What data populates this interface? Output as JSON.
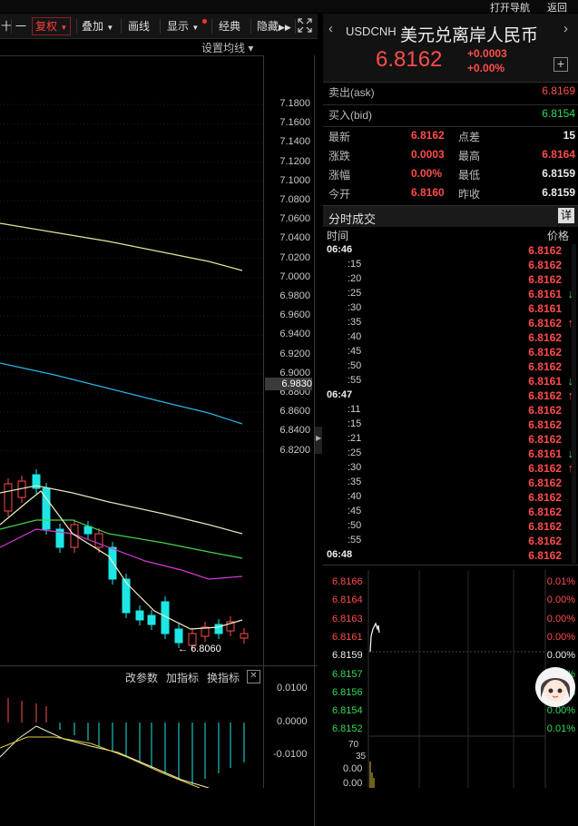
{
  "topbar": {
    "open_nav": "打开导航",
    "back": "返回"
  },
  "toolbar": {
    "items": [
      "十",
      "一",
      "复权",
      "叠加",
      "画线",
      "显示",
      "经典",
      "隐藏"
    ],
    "settings": "设置均线 ▾"
  },
  "main_chart": {
    "y_ticks": [
      "7.1800",
      "7.1600",
      "7.1400",
      "7.1200",
      "7.1000",
      "7.0800",
      "7.0600",
      "7.0400",
      "7.0200",
      "7.0000",
      "6.9800",
      "6.9600",
      "6.9400",
      "6.9200",
      "6.9000",
      "6.8800",
      "6.8600",
      "6.8400",
      "6.8200"
    ],
    "current_price_tag": "6.9830",
    "low_marker": "6.8060"
  },
  "indicator": {
    "buttons": [
      "改参数",
      "加指标",
      "换指标"
    ],
    "y_ticks": [
      "0.0100",
      "0.0000",
      "-0.0100"
    ]
  },
  "quote": {
    "symbol": "USDCNH",
    "name": "美元兑离岸人民币",
    "price": "6.8162",
    "change": "+0.0003",
    "change_pct": "+0.00%",
    "ask_label": "卖出(ask)",
    "ask": "6.8169",
    "bid_label": "买入(bid)",
    "bid": "6.8154",
    "stats": [
      {
        "l1": "最新",
        "v1": "6.8162",
        "c1": "red",
        "l2": "点差",
        "v2": "15",
        "c2": "white"
      },
      {
        "l1": "涨跌",
        "v1": "0.0003",
        "c1": "red",
        "l2": "最高",
        "v2": "6.8164",
        "c2": "red"
      },
      {
        "l1": "涨幅",
        "v1": "0.00%",
        "c1": "red",
        "l2": "最低",
        "v2": "6.8159",
        "c2": "white"
      },
      {
        "l1": "今开",
        "v1": "6.8160",
        "c1": "red",
        "l2": "昨收",
        "v2": "6.8159",
        "c2": "white"
      }
    ]
  },
  "ticks_panel": {
    "title": "分时成交",
    "detail_btn": "详",
    "col_time": "时间",
    "col_price": "价格",
    "rows": [
      {
        "t": "06:46",
        "p": "6.8162",
        "a": "",
        "b": true
      },
      {
        "t": ":15",
        "p": "6.8162",
        "a": ""
      },
      {
        "t": ":20",
        "p": "6.8162",
        "a": ""
      },
      {
        "t": ":25",
        "p": "6.8161",
        "a": "down"
      },
      {
        "t": ":30",
        "p": "6.8161",
        "a": ""
      },
      {
        "t": ":35",
        "p": "6.8162",
        "a": "up"
      },
      {
        "t": ":40",
        "p": "6.8162",
        "a": ""
      },
      {
        "t": ":45",
        "p": "6.8162",
        "a": ""
      },
      {
        "t": ":50",
        "p": "6.8162",
        "a": ""
      },
      {
        "t": ":55",
        "p": "6.8161",
        "a": "down"
      },
      {
        "t": "06:47",
        "p": "6.8162",
        "a": "up",
        "b": true
      },
      {
        "t": ":11",
        "p": "6.8162",
        "a": ""
      },
      {
        "t": ":15",
        "p": "6.8162",
        "a": ""
      },
      {
        "t": ":21",
        "p": "6.8162",
        "a": ""
      },
      {
        "t": ":25",
        "p": "6.8161",
        "a": "down"
      },
      {
        "t": ":30",
        "p": "6.8162",
        "a": "up"
      },
      {
        "t": ":35",
        "p": "6.8162",
        "a": ""
      },
      {
        "t": ":40",
        "p": "6.8162",
        "a": ""
      },
      {
        "t": ":45",
        "p": "6.8162",
        "a": ""
      },
      {
        "t": ":50",
        "p": "6.8162",
        "a": ""
      },
      {
        "t": ":55",
        "p": "6.8162",
        "a": ""
      },
      {
        "t": "06:48",
        "p": "6.8162",
        "a": "",
        "b": true
      }
    ]
  },
  "mini_chart": {
    "left_labels": [
      {
        "v": "6.8166",
        "c": "red"
      },
      {
        "v": "6.8164",
        "c": "red"
      },
      {
        "v": "6.8163",
        "c": "red"
      },
      {
        "v": "6.8161",
        "c": "red"
      },
      {
        "v": "6.8159",
        "c": "white"
      },
      {
        "v": "6.8157",
        "c": "green"
      },
      {
        "v": "6.8156",
        "c": "green"
      },
      {
        "v": "6.8154",
        "c": "green"
      },
      {
        "v": "6.8152",
        "c": "green"
      }
    ],
    "right_labels": [
      {
        "v": "0.01%",
        "c": "red"
      },
      {
        "v": "0.00%",
        "c": "red"
      },
      {
        "v": "0.00%",
        "c": "red"
      },
      {
        "v": "0.00%",
        "c": "red"
      },
      {
        "v": "0.00%",
        "c": "white"
      },
      {
        "v": "0.00%",
        "c": "green"
      },
      {
        "v": "0.00%",
        "c": "green"
      },
      {
        "v": "0.00%",
        "c": "green"
      },
      {
        "v": "0.01%",
        "c": "green"
      }
    ],
    "vol_labels": [
      "70",
      "35",
      "0.00",
      "0.00"
    ]
  },
  "colors": {
    "up": "#ff4c4c",
    "down": "#2fdc5a",
    "cyan": "#1ee6e6"
  }
}
